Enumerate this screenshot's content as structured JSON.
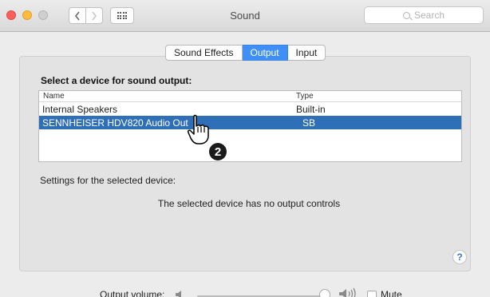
{
  "window": {
    "title": "Sound"
  },
  "toolbar": {
    "back_icon": "chevron-left-icon",
    "forward_icon": "chevron-right-icon",
    "grid_icon": "show-all-grid-icon",
    "search_placeholder": "Search"
  },
  "tabs": [
    {
      "label": "Sound Effects",
      "active": false
    },
    {
      "label": "Output",
      "active": true
    },
    {
      "label": "Input",
      "active": false
    }
  ],
  "output": {
    "section_title": "Select a device for sound output:",
    "columns": {
      "name": "Name",
      "type": "Type"
    },
    "devices": [
      {
        "name": "Internal Speakers",
        "type": "Built-in",
        "selected": false
      },
      {
        "name": "SENNHEISER HDV820 Audio Out",
        "type": "SB",
        "selected": true
      }
    ],
    "settings_label": "Settings for the selected device:",
    "no_controls_text": "The selected device has no output controls"
  },
  "help": {
    "label": "?"
  },
  "footer": {
    "volume_label": "Output volume:",
    "volume_level": 1.0,
    "mute_label": "Mute",
    "mute_checked": false
  },
  "annotation": {
    "step_number": "2"
  },
  "colors": {
    "accent": "#3f8ff7",
    "selection": "#2f6fb8"
  }
}
